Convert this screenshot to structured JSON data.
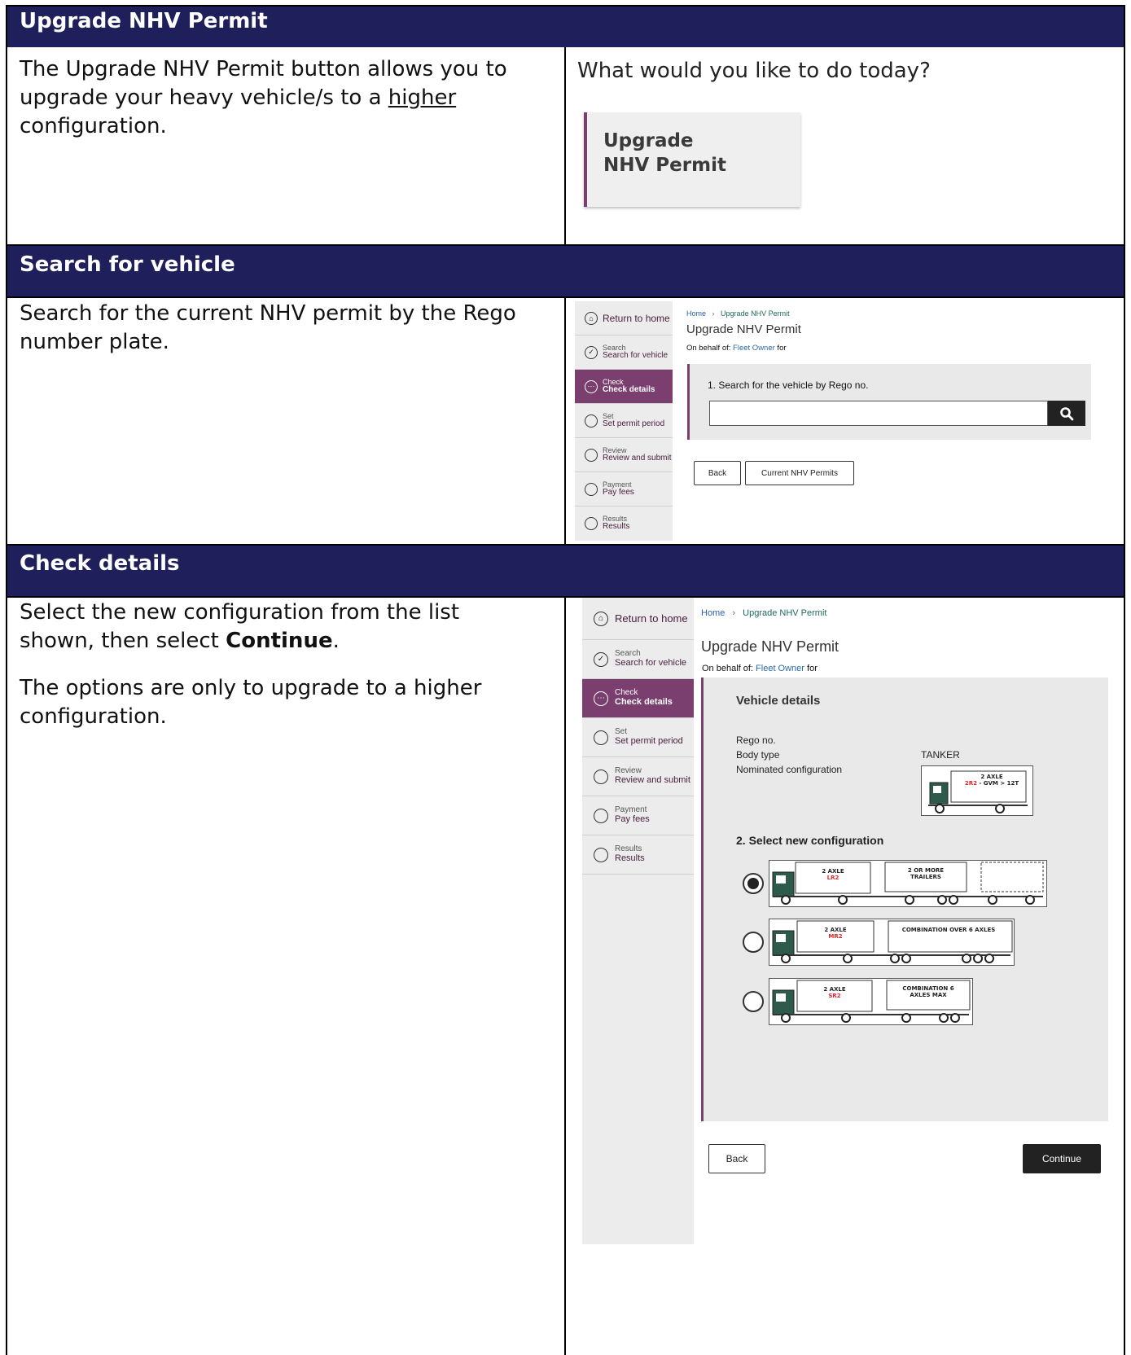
{
  "sections": [
    {
      "header": "Upgrade NHV Permit",
      "description": {
        "before": "The Upgrade NHV Permit button allows you to upgrade your heavy vehicle/s to a ",
        "underline": "higher",
        "after": " configuration."
      },
      "screen": {
        "prompt": "What would you like to do today?",
        "tile_label": "Upgrade NHV Permit"
      }
    },
    {
      "header": "Search for vehicle",
      "description": "Search for the current NHV permit by the Rego number plate.",
      "screen": {
        "panel_heading": "1. Search for the vehicle by Rego no.",
        "search_value": "",
        "buttons": [
          "Back",
          "Current NHV Permits"
        ]
      }
    },
    {
      "header": "Check details",
      "description": {
        "p1_before": "Select the new configuration from the list shown, then select ",
        "p1_bold": "Continue",
        "p1_after": ".",
        "p2": "The options are only to upgrade to a higher configuration."
      },
      "screen": {
        "panel_heading": "Vehicle details",
        "fields": [
          {
            "label": "Rego no.",
            "value": ""
          },
          {
            "label": "Body type",
            "value": "TANKER"
          },
          {
            "label": "Nominated configuration",
            "value": ""
          }
        ],
        "nominated_image": {
          "line1": "2 AXLE",
          "code": "2R2",
          "rest": " - GVM > 12T"
        },
        "select_heading": "2. Select new configuration",
        "options": [
          {
            "axle": "2 AXLE",
            "code": "LR2",
            "trailer": "2 OR MORE TRAILERS",
            "selected": true
          },
          {
            "axle": "2 AXLE",
            "code": "MR2",
            "trailer": "COMBINATION OVER 6 AXLES",
            "selected": false
          },
          {
            "axle": "2 AXLE",
            "code": "SR2",
            "trailer": "COMBINATION 6 AXLES MAX",
            "selected": false
          }
        ],
        "buttons": {
          "back": "Back",
          "continue": "Continue"
        }
      }
    }
  ],
  "app": {
    "return_home": "Return to home",
    "breadcrumb": {
      "home": "Home",
      "separator": "›",
      "current": "Upgrade NHV Permit"
    },
    "page_title": "Upgrade NHV Permit",
    "behalf": {
      "prefix": "On behalf of: ",
      "owner": "Fleet Owner",
      "suffix": " for"
    },
    "steps": [
      {
        "small": "Search",
        "bold": "Search for vehicle"
      },
      {
        "small": "Check",
        "bold": "Check details"
      },
      {
        "small": "Set",
        "bold": "Set permit period"
      },
      {
        "small": "Review",
        "bold": "Review and submit"
      },
      {
        "small": "Payment",
        "bold": "Pay fees"
      },
      {
        "small": "Results",
        "bold": "Results"
      }
    ]
  }
}
